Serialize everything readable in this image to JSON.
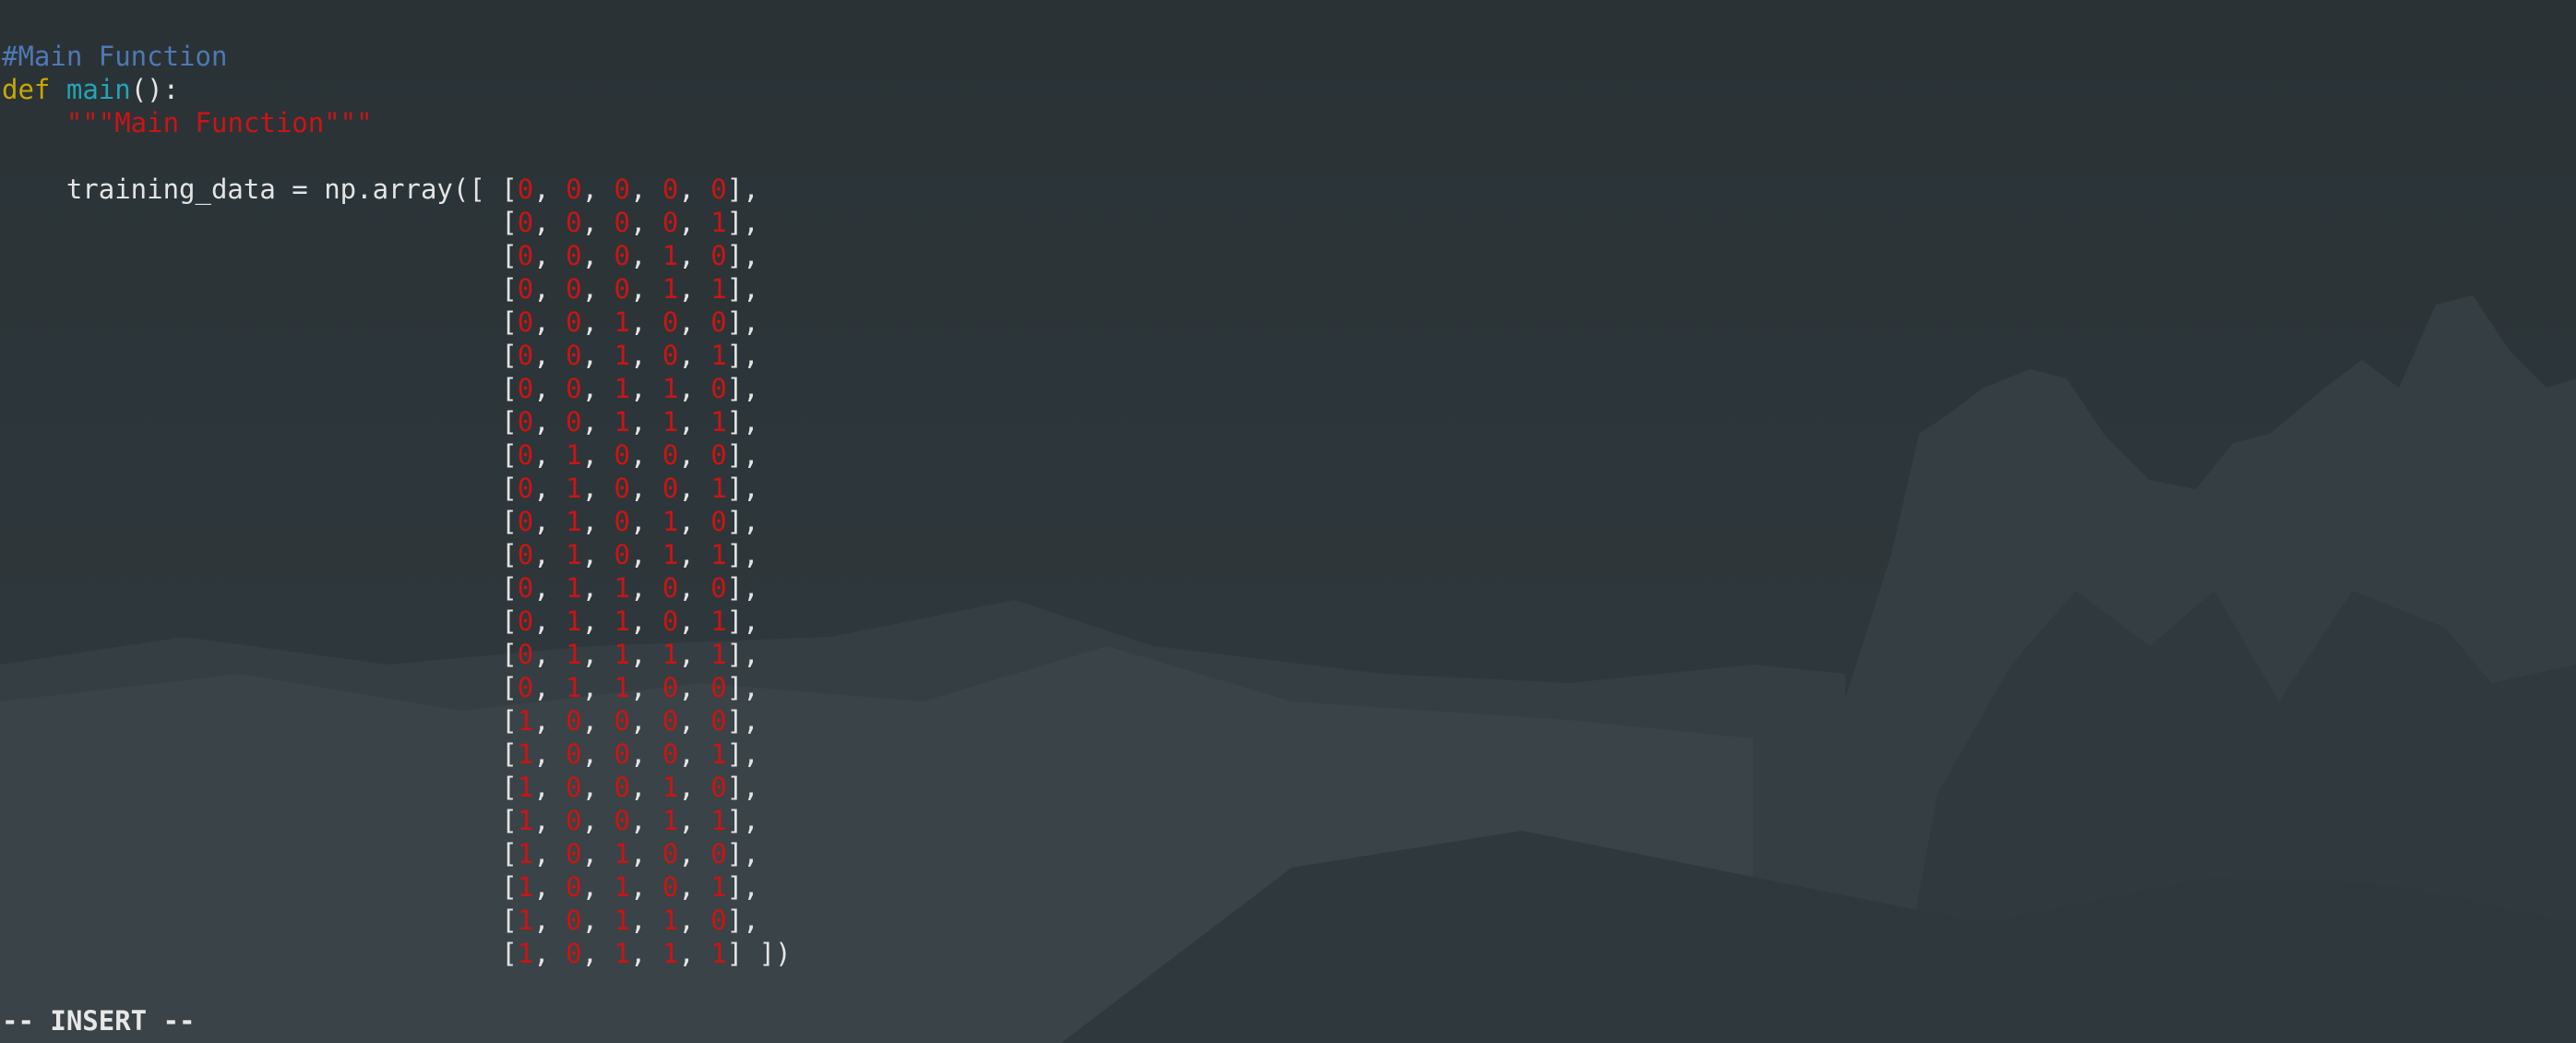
{
  "editor": {
    "comment": "#Main Function",
    "def_keyword": "def",
    "func_name": "main",
    "func_sig_rest": "():",
    "indent": "    ",
    "docstring": "\"\"\"Main Function\"\"\"",
    "assignment_prefix": "training_data = np.array([ ",
    "row_indent": "                           ",
    "last_row_suffix": " ])",
    "row_suffix": ",",
    "training_rows": [
      [
        0,
        0,
        0,
        0,
        0
      ],
      [
        0,
        0,
        0,
        0,
        1
      ],
      [
        0,
        0,
        0,
        1,
        0
      ],
      [
        0,
        0,
        0,
        1,
        1
      ],
      [
        0,
        0,
        1,
        0,
        0
      ],
      [
        0,
        0,
        1,
        0,
        1
      ],
      [
        0,
        0,
        1,
        1,
        0
      ],
      [
        0,
        0,
        1,
        1,
        1
      ],
      [
        0,
        1,
        0,
        0,
        0
      ],
      [
        0,
        1,
        0,
        0,
        1
      ],
      [
        0,
        1,
        0,
        1,
        0
      ],
      [
        0,
        1,
        0,
        1,
        1
      ],
      [
        0,
        1,
        1,
        0,
        0
      ],
      [
        0,
        1,
        1,
        0,
        1
      ],
      [
        0,
        1,
        1,
        1,
        1
      ],
      [
        0,
        1,
        1,
        0,
        0
      ],
      [
        1,
        0,
        0,
        0,
        0
      ],
      [
        1,
        0,
        0,
        0,
        1
      ],
      [
        1,
        0,
        0,
        1,
        0
      ],
      [
        1,
        0,
        0,
        1,
        1
      ],
      [
        1,
        0,
        1,
        0,
        0
      ],
      [
        1,
        0,
        1,
        0,
        1
      ],
      [
        1,
        0,
        1,
        1,
        0
      ],
      [
        1,
        0,
        1,
        1,
        1
      ]
    ]
  },
  "status": {
    "mode_text": "-- INSERT --"
  },
  "colors": {
    "background": "#2c3438",
    "comment": "#4f78b3",
    "keyword": "#c9a800",
    "function": "#21a6b5",
    "string_number": "#cc1414",
    "text": "#e4e4e4"
  }
}
